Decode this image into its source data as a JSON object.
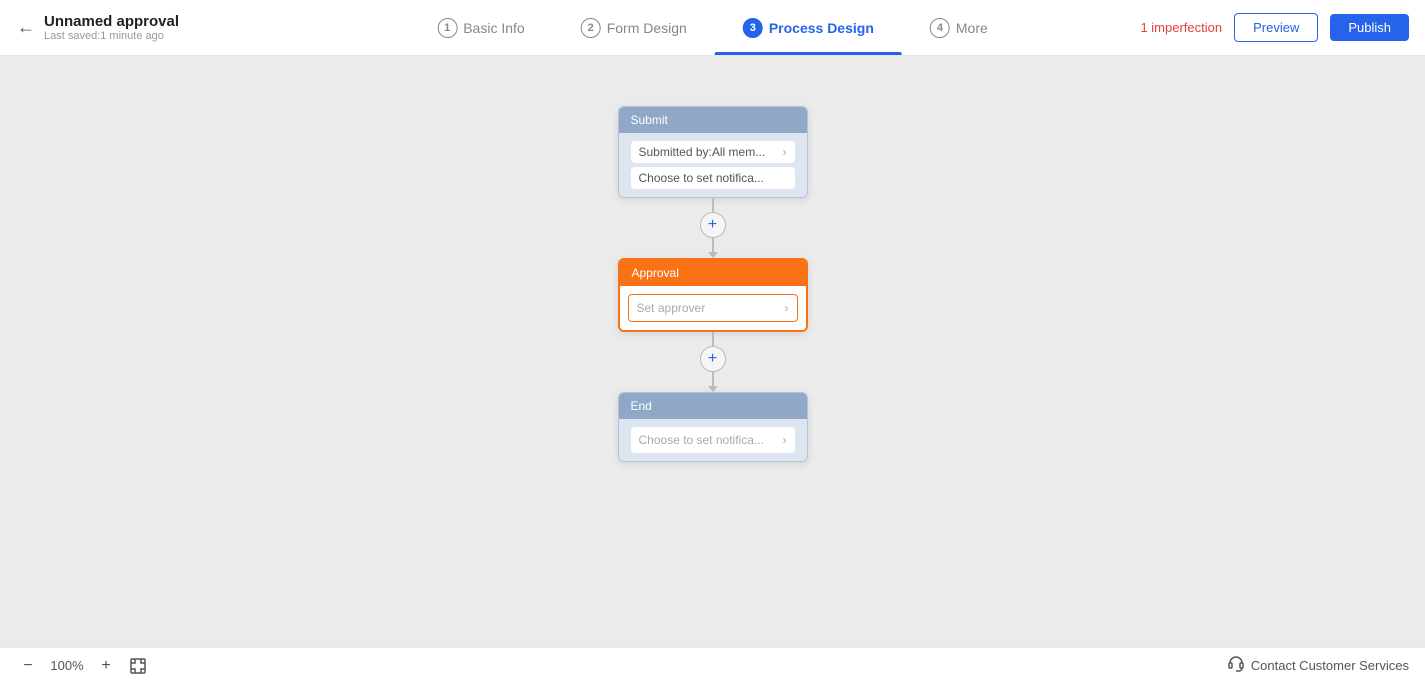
{
  "header": {
    "back_icon": "←",
    "app_title": "Unnamed approval",
    "app_subtitle": "Last saved:1 minute ago",
    "tabs": [
      {
        "num": "1",
        "label": "Basic Info",
        "active": false
      },
      {
        "num": "2",
        "label": "Form Design",
        "active": false
      },
      {
        "num": "3",
        "label": "Process Design",
        "active": true
      },
      {
        "num": "4",
        "label": "More",
        "active": false
      }
    ],
    "imperfection": "1 imperfection",
    "preview_label": "Preview",
    "publish_label": "Publish"
  },
  "flow": {
    "submit_node": {
      "header": "Submit",
      "row1_text": "Submitted by:All mem...",
      "row2_text": "Choose to set notifica..."
    },
    "add_btn1": "+",
    "approval_node": {
      "header": "Approval",
      "placeholder": "Set approver"
    },
    "add_btn2": "+",
    "end_node": {
      "header": "End",
      "row_text": "Choose to set notifica..."
    }
  },
  "footer": {
    "zoom_out": "−",
    "zoom_level": "100%",
    "zoom_in": "+",
    "fit_icon": "⊡",
    "customer_service_icon": "🎧",
    "customer_service_label": "Contact Customer Services"
  }
}
